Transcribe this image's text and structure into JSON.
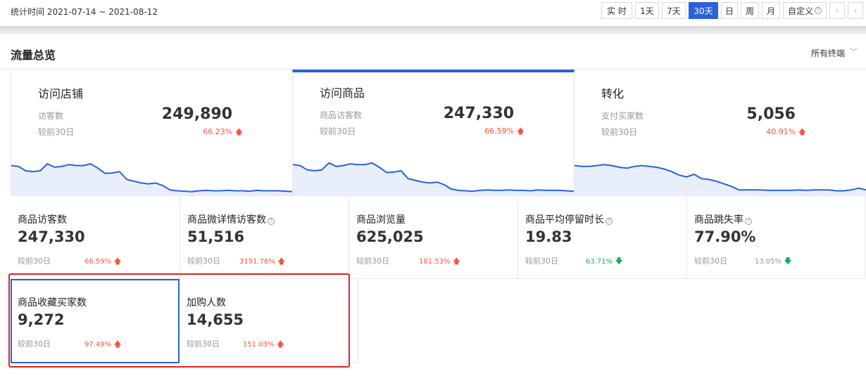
{
  "header": {
    "stat_time": "统计时间 2021-07-14 ~ 2021-08-12",
    "range_buttons": [
      "实 时",
      "1天",
      "7天",
      "30天",
      "日",
      "周",
      "月",
      "自定义"
    ],
    "active_range": "30天",
    "prev_icon": "chevron-left-icon",
    "next_icon": "chevron-right-icon"
  },
  "section": {
    "title": "流量总览",
    "terminal": "所有终端"
  },
  "panels": [
    {
      "title": "访问店铺",
      "label": "访客数",
      "value": "249,890",
      "compare": "较前30日",
      "change": "66.23%",
      "trend": "up",
      "spark": [
        0.62,
        0.6,
        0.5,
        0.48,
        0.5,
        0.66,
        0.58,
        0.6,
        0.64,
        0.62,
        0.62,
        0.66,
        0.56,
        0.44,
        0.45,
        0.48,
        0.3,
        0.26,
        0.22,
        0.2,
        0.22,
        0.16,
        0.06,
        0.04,
        0.03,
        0.02,
        0.04,
        0.05,
        0.04,
        0.04,
        0.05,
        0.04,
        0.04,
        0.03,
        0.05,
        0.04,
        0.04,
        0.04,
        0.03,
        0.02
      ]
    },
    {
      "title": "访问商品",
      "label": "商品访客数",
      "value": "247,330",
      "compare": "较前30日",
      "change": "66.59%",
      "trend": "up",
      "spark": [
        0.64,
        0.62,
        0.52,
        0.5,
        0.52,
        0.68,
        0.6,
        0.62,
        0.66,
        0.64,
        0.64,
        0.68,
        0.58,
        0.46,
        0.47,
        0.5,
        0.32,
        0.28,
        0.24,
        0.22,
        0.24,
        0.18,
        0.08,
        0.05,
        0.04,
        0.03,
        0.05,
        0.06,
        0.05,
        0.05,
        0.06,
        0.05,
        0.05,
        0.04,
        0.06,
        0.05,
        0.05,
        0.05,
        0.04,
        0.03
      ]
    },
    {
      "title": "转化",
      "label": "支付买家数",
      "value": "5,056",
      "compare": "较前30日",
      "change": "40.91%",
      "trend": "up",
      "spark": [
        0.62,
        0.6,
        0.6,
        0.62,
        0.64,
        0.62,
        0.58,
        0.56,
        0.6,
        0.62,
        0.6,
        0.58,
        0.54,
        0.48,
        0.4,
        0.36,
        0.42,
        0.32,
        0.3,
        0.26,
        0.2,
        0.14,
        0.06,
        0.06,
        0.06,
        0.06,
        0.05,
        0.05,
        0.05,
        0.05,
        0.06,
        0.05,
        0.06,
        0.06,
        0.06,
        0.04,
        0.04,
        0.06,
        0.1,
        0.06
      ]
    }
  ],
  "metrics": [
    {
      "title": "商品访客数",
      "help": false,
      "value": "247,330",
      "compare": "较前30日",
      "change": "66.59%",
      "trend": "up",
      "color": "red"
    },
    {
      "title": "商品微详情访客数",
      "help": true,
      "value": "51,516",
      "compare": "较前30日",
      "change": "3191.76%",
      "trend": "up",
      "color": "red"
    },
    {
      "title": "商品浏览量",
      "help": false,
      "value": "625,025",
      "compare": "较前30日",
      "change": "181.53%",
      "trend": "up",
      "color": "red"
    },
    {
      "title": "商品平均停留时长",
      "help": true,
      "value": "19.83",
      "compare": "较前30日",
      "change": "63.71%",
      "trend": "down",
      "color": "green"
    },
    {
      "title": "商品跳失率",
      "help": true,
      "value": "77.90%",
      "compare": "较前30日",
      "change": "13.05%",
      "trend": "down",
      "color": "gray"
    }
  ],
  "metrics_row2": [
    {
      "title": "商品收藏买家数",
      "value": "9,272",
      "compare": "较前30日",
      "change": "97.49%",
      "trend": "up",
      "color": "red"
    },
    {
      "title": "加购人数",
      "value": "14,655",
      "compare": "较前30日",
      "change": "151.03%",
      "trend": "up",
      "color": "red"
    }
  ],
  "colors": {
    "accent": "#2962d9",
    "up": "#f5553b",
    "down": "#1aad5a",
    "highlight_box": "#e62020"
  }
}
